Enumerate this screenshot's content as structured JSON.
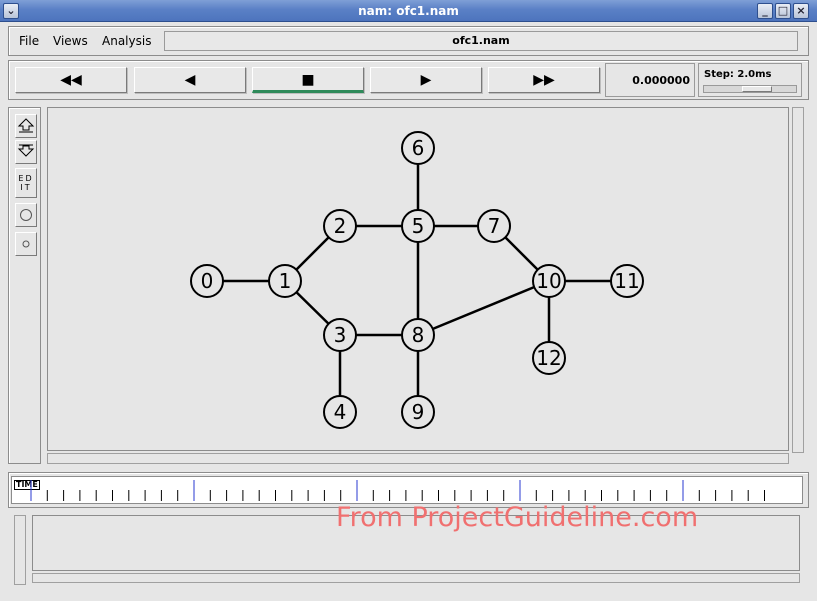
{
  "window": {
    "title": "nam: ofc1.nam"
  },
  "menu": {
    "file": "File",
    "views": "Views",
    "analysis": "Analysis"
  },
  "filename": "ofc1.nam",
  "controls": {
    "rewind": "◀◀",
    "back": "◀",
    "stop": "■",
    "play": "▶",
    "fastforward": "▶▶",
    "time": "0.000000",
    "step": "Step: 2.0ms"
  },
  "tools": {
    "edit": "ED IT"
  },
  "timeline": {
    "label": "TIME"
  },
  "topology": {
    "nodes": [
      "0",
      "1",
      "2",
      "3",
      "4",
      "5",
      "6",
      "7",
      "8",
      "9",
      "10",
      "11",
      "12"
    ],
    "links": [
      [
        "0",
        "1"
      ],
      [
        "1",
        "2"
      ],
      [
        "1",
        "3"
      ],
      [
        "2",
        "5"
      ],
      [
        "3",
        "8"
      ],
      [
        "3",
        "4"
      ],
      [
        "5",
        "6"
      ],
      [
        "5",
        "7"
      ],
      [
        "5",
        "8"
      ],
      [
        "8",
        "9"
      ],
      [
        "8",
        "10"
      ],
      [
        "7",
        "10"
      ],
      [
        "10",
        "11"
      ],
      [
        "10",
        "12"
      ]
    ]
  },
  "watermark": "From ProjectGuideline.com"
}
